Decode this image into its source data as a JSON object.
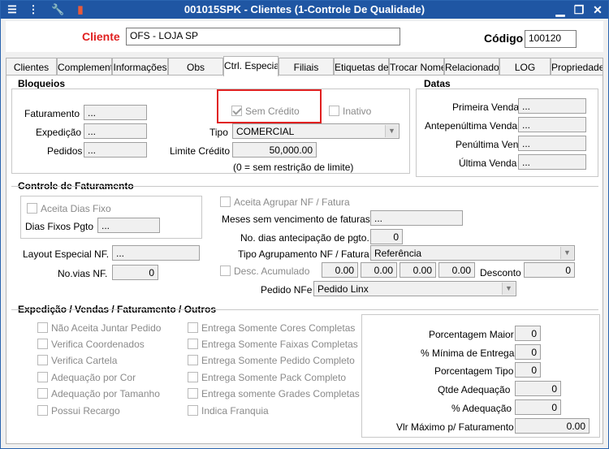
{
  "window": {
    "title": "001015SPK - Clientes (1-Controle De Qualidade)",
    "toolbar_icons": [
      "list-icon",
      "traffic-light-icon",
      "wrench-icon",
      "book-icon"
    ],
    "controls": {
      "minimize": "▁",
      "restore": "❐",
      "close": "✕"
    }
  },
  "header": {
    "cliente_label": "Cliente",
    "cliente_value": "OFS - LOJA SP",
    "codigo_label": "Código",
    "codigo_value": "100120"
  },
  "tabs": [
    "Clientes",
    "Complementos",
    "Informações",
    "Obs",
    "Ctrl. Especial",
    "Filiais",
    "Etiquetas de",
    "Trocar Nome",
    "Relacionados",
    "LOG",
    "Propriedades"
  ],
  "bloqueios": {
    "title": "Bloqueios",
    "faturamento_label": "Faturamento",
    "faturamento_value": "...",
    "expedicao_label": "Expedição",
    "expedicao_value": "...",
    "pedidos_label": "Pedidos",
    "pedidos_value": "...",
    "sem_credito_label": "Sem Crédito",
    "inativo_label": "Inativo",
    "tipo_label": "Tipo",
    "tipo_value": "COMERCIAL",
    "limite_label": "Limite Crédito",
    "limite_value": "50,000.00",
    "limite_note": "(0 = sem restrição de limite)"
  },
  "datas": {
    "title": "Datas",
    "primeira_label": "Primeira Venda",
    "primeira_value": "...",
    "antepenultima_label": "Antepenúltima Venda",
    "antepenultima_value": "...",
    "penultima_label": "Penúltima Venda",
    "penultima_value": "...",
    "ultima_label": "Última Venda",
    "ultima_value": "..."
  },
  "faturamento": {
    "title": "Controle de Faturamento",
    "aceita_dias_fixo": "Aceita Dias Fixo",
    "dias_fixos_label": "Dias Fixos Pgto",
    "dias_fixos_value": "...",
    "layout_label": "Layout Especial NF.",
    "layout_value": "...",
    "novias_label": "No.vias NF.",
    "novias_value": "0",
    "aceita_agrupar": "Aceita Agrupar NF / Fatura",
    "meses_label": "Meses sem vencimento de faturas",
    "meses_value": "...",
    "dias_antecip_label": "No. dias antecipação de pgto.",
    "dias_antecip_value": "0",
    "tipo_agrup_label": "Tipo Agrupamento NF / Fatura",
    "tipo_agrup_value": "Referência",
    "desc_acum_label": "Desc. Acumulado",
    "desc_values": [
      "0.00",
      "0.00",
      "0.00",
      "0.00"
    ],
    "desconto_label": "Desconto",
    "desconto_value": "0",
    "pedido_nfe_label": "Pedido NFe",
    "pedido_nfe_value": "Pedido Linx"
  },
  "expedicao": {
    "title": "Expedição / Vendas / Faturamento / Outros",
    "col1": [
      "Não Aceita Juntar Pedido",
      "Verifica Coordenados",
      "Verifica Cartela",
      "Adequação por Cor",
      "Adequação por Tamanho",
      "Possui Recargo"
    ],
    "col2": [
      "Entrega Somente Cores Completas",
      "Entrega Somente Faixas Completas",
      "Entrega Somente Pedido Completo",
      "Entrega Somente Pack Completo",
      "Entrega somente Grades Completas",
      "Indica Franquia"
    ],
    "porc_maior_label": "Porcentagem Maior",
    "porc_maior_value": "0",
    "min_entrega_label": "% Mínima de Entrega",
    "min_entrega_value": "0",
    "porc_tipo_label": "Porcentagem Tipo",
    "porc_tipo_value": "0",
    "qtde_adeq_label": "Qtde Adequação",
    "qtde_adeq_value": "0",
    "perc_adeq_label": "% Adequação",
    "perc_adeq_value": "0",
    "vlr_max_label": "Vlr Máximo p/ Faturamento",
    "vlr_max_value": "0.00"
  }
}
